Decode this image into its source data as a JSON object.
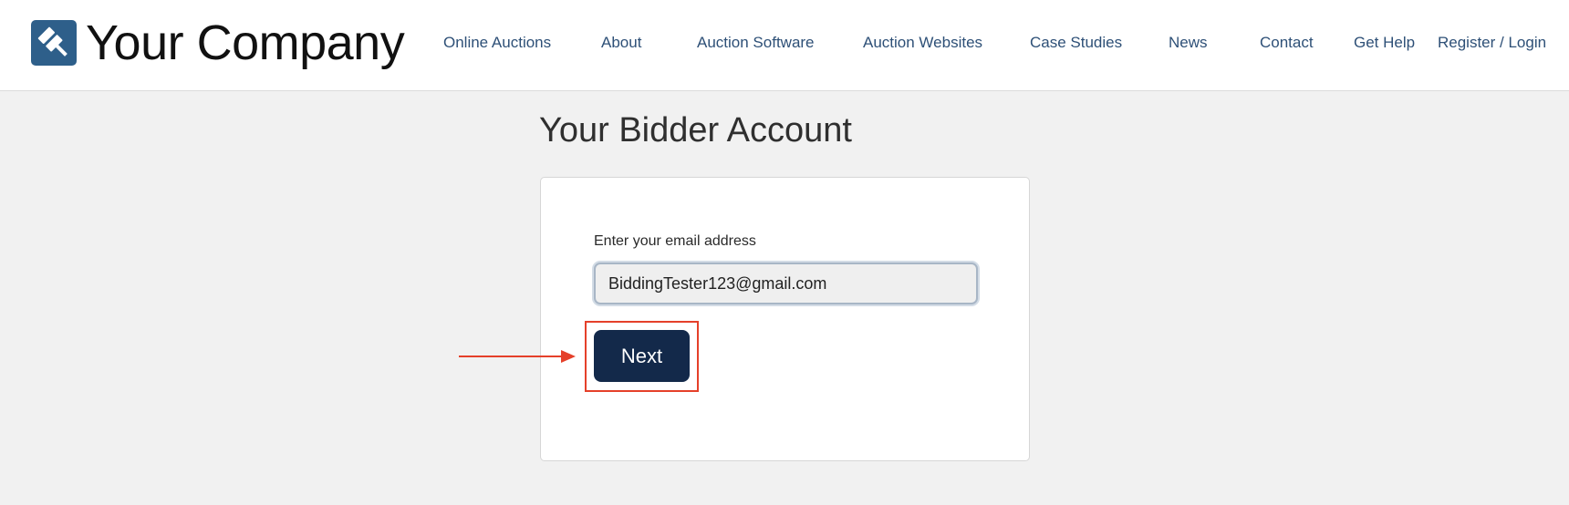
{
  "header": {
    "company_name": "Your Company",
    "logo_icon": "gavel-icon",
    "nav": [
      {
        "label": "Online Auctions"
      },
      {
        "label": "About"
      },
      {
        "label": "Auction Software"
      },
      {
        "label": "Auction Websites"
      },
      {
        "label": "Case Studies"
      },
      {
        "label": "News"
      },
      {
        "label": "Contact"
      },
      {
        "label": "Get Help"
      },
      {
        "label": "Register / Login"
      }
    ]
  },
  "page": {
    "title": "Your Bidder Account"
  },
  "form": {
    "email_label": "Enter your email address",
    "email_value": "BiddingTester123@gmail.com",
    "next_label": "Next"
  },
  "annotation": {
    "color": "#e5402a",
    "arrow_icon": "arrow-right-icon"
  },
  "colors": {
    "brand": "#2e5f8a",
    "nav_text": "#2e5077",
    "button": "#13294a",
    "background": "#f1f1f1"
  }
}
